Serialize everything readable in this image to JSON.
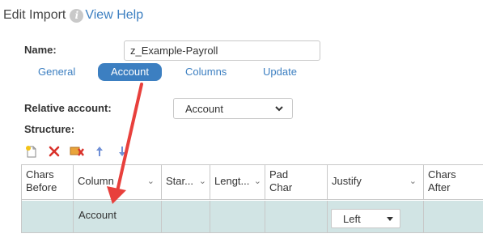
{
  "header": {
    "title": "Edit Import",
    "help_label": "View Help",
    "help_icon": "info-icon"
  },
  "form": {
    "name_label": "Name:",
    "name_value": "z_Example-Payroll",
    "relative_account_label": "Relative account:",
    "relative_account_value": "Account",
    "structure_label": "Structure:"
  },
  "tabs": [
    {
      "label": "General",
      "active": false
    },
    {
      "label": "Account",
      "active": true
    },
    {
      "label": "Columns",
      "active": false
    },
    {
      "label": "Update",
      "active": false
    }
  ],
  "toolbar": {
    "icons": [
      "add-row-icon",
      "delete-icon",
      "clear-icon",
      "move-up-icon",
      "move-down-icon"
    ]
  },
  "grid": {
    "columns": [
      {
        "label": "Chars\nBefore",
        "sortable": false
      },
      {
        "label": "Column",
        "sortable": true
      },
      {
        "label": "Star...",
        "sortable": true
      },
      {
        "label": "Lengt...",
        "sortable": true
      },
      {
        "label": "Pad\nChar",
        "sortable": false
      },
      {
        "label": "Justify",
        "sortable": true
      },
      {
        "label": "Chars\nAfter",
        "sortable": false
      }
    ],
    "rows": [
      {
        "chars_before": "",
        "column": "Account",
        "start": "",
        "length": "",
        "pad_char": "",
        "justify": "Left",
        "chars_after": ""
      }
    ]
  },
  "colors": {
    "accent": "#3c7fc1",
    "selected_row": "#d1e4e4",
    "annotation_arrow": "#e8403c",
    "delete_icon": "#d9322b"
  }
}
